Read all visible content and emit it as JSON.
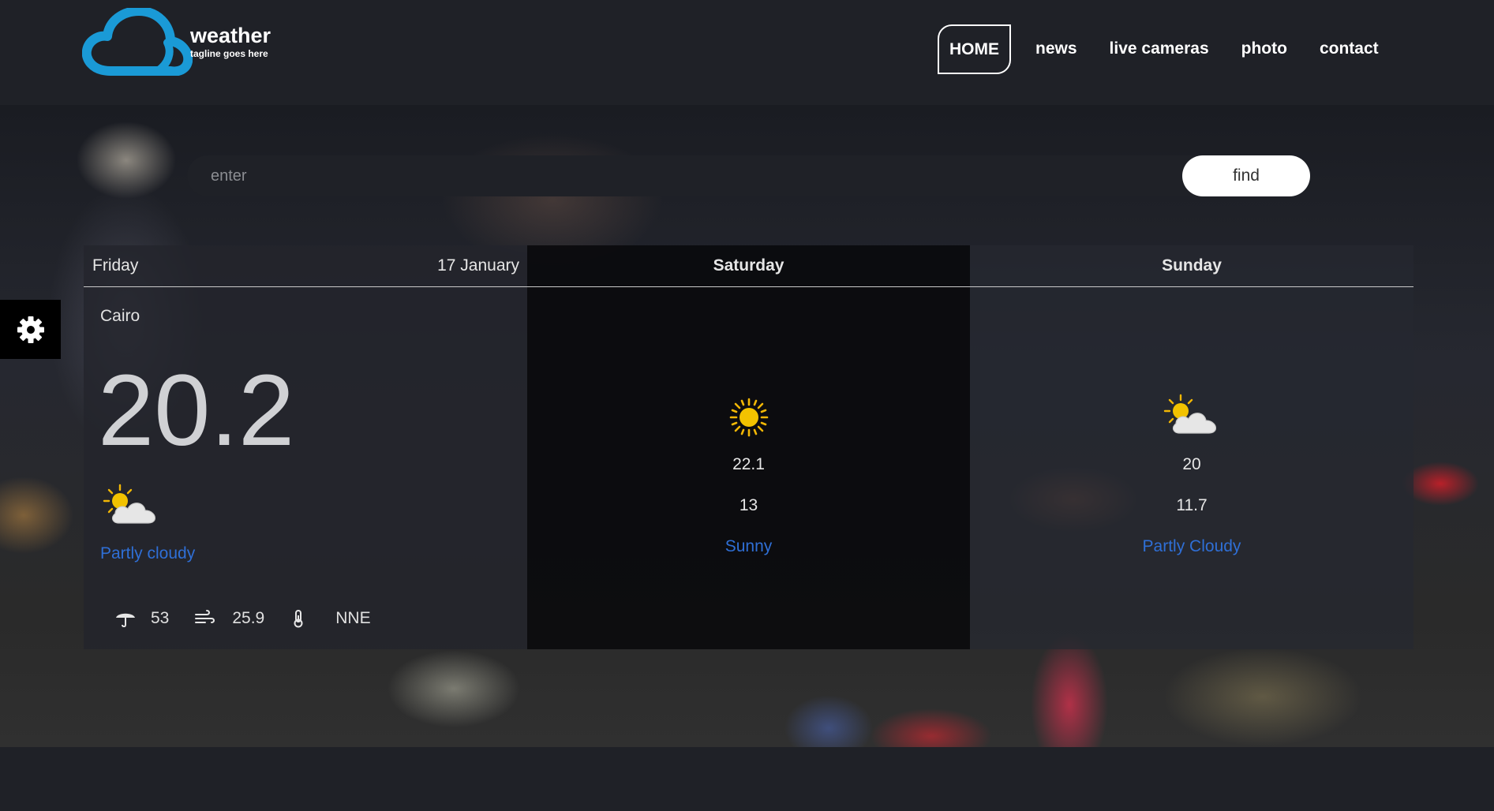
{
  "brand": {
    "name": "weather",
    "tagline": "tagline goes here",
    "accent_color": "#1a9ad6"
  },
  "nav": {
    "items": [
      {
        "label": "HOME",
        "active": true
      },
      {
        "label": "news"
      },
      {
        "label": "live cameras"
      },
      {
        "label": "photo"
      },
      {
        "label": "contact"
      }
    ]
  },
  "search": {
    "placeholder": "enter",
    "button_label": "find"
  },
  "settings": {
    "icon": "gear-icon"
  },
  "today": {
    "day": "Friday",
    "date": "17 January",
    "city": "Cairo",
    "temperature": "20.2",
    "icon": "partly-cloudy-icon",
    "condition": "Partly cloudy",
    "humidity": "53",
    "wind_speed": "25.9",
    "wind_direction": "NNE",
    "condition_color": "#2f6fd6"
  },
  "forecast": [
    {
      "day": "Saturday",
      "icon": "sun-icon",
      "max": "22.1",
      "min": "13",
      "condition": "Sunny"
    },
    {
      "day": "Sunday",
      "icon": "partly-cloudy-icon",
      "max": "20",
      "min": "11.7",
      "condition": "Partly Cloudy"
    }
  ]
}
